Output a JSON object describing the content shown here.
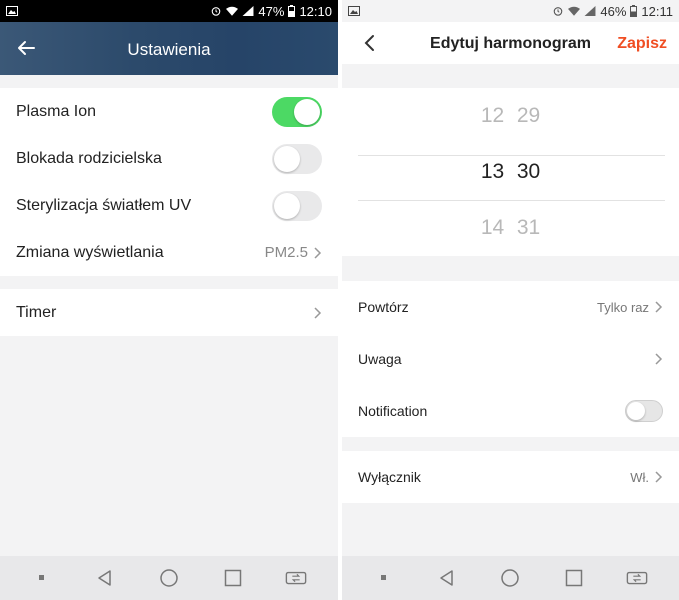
{
  "left": {
    "status": {
      "battery": "47%",
      "time": "12:10"
    },
    "header": {
      "title": "Ustawienia"
    },
    "settings": [
      {
        "label": "Plasma Ion",
        "toggle": "on"
      },
      {
        "label": "Blokada rodzicielska",
        "toggle": "off"
      },
      {
        "label": "Sterylizacja światłem UV",
        "toggle": "off"
      },
      {
        "label": "Zmiana wyświetlania",
        "value": "PM2.5"
      }
    ],
    "timer": {
      "label": "Timer"
    }
  },
  "right": {
    "status": {
      "battery": "46%",
      "time": "12:11"
    },
    "header": {
      "title": "Edytuj harmonogram",
      "save_label": "Zapisz"
    },
    "picker": {
      "rows": [
        {
          "hour": "12",
          "minute": "29"
        },
        {
          "hour": "13",
          "minute": "30"
        },
        {
          "hour": "14",
          "minute": "31"
        }
      ]
    },
    "options": [
      {
        "label": "Powtórz",
        "value": "Tylko raz"
      },
      {
        "label": "Uwaga",
        "value": ""
      },
      {
        "label": "Notification",
        "toggle": "off"
      }
    ],
    "switch": {
      "label": "Wyłącznik",
      "value": "Wł."
    }
  },
  "colors": {
    "accent": "#f04e23",
    "toggle_on": "#4cd964",
    "header_blue": "#2c4a6b"
  },
  "icons": [
    "image-icon",
    "alarm-icon",
    "wifi-icon",
    "signal-icon",
    "battery-icon",
    "back-arrow-icon",
    "chevron-right-icon",
    "back-triangle-icon",
    "home-circle-icon",
    "recents-square-icon",
    "screen-switch-icon",
    "dot-icon"
  ]
}
